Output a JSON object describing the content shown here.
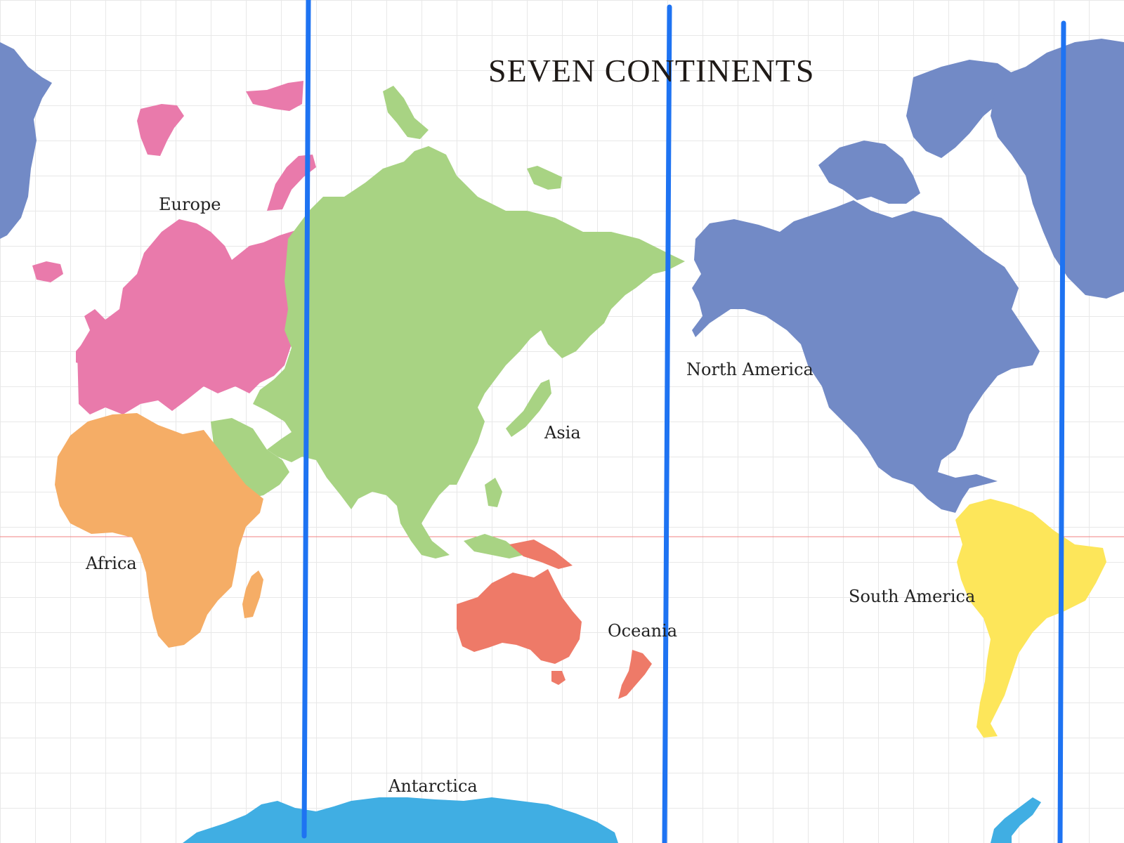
{
  "title": "SEVEN CONTINENTS",
  "labels": {
    "europe": "Europe",
    "asia": "Asia",
    "north_america": "North America",
    "africa": "Africa",
    "south_america": "South America",
    "oceania": "Oceania",
    "antarctica": "Antarctica"
  },
  "colors": {
    "europe": "#e97aab",
    "asia": "#a8d383",
    "north_america": "#728ac6",
    "africa": "#f5ad66",
    "south_america": "#fde65a",
    "oceania": "#ee7a68",
    "antarctica": "#40aee3",
    "grid": "#e8e8e8",
    "equator": "#f08080",
    "drawn_lines": "#1e73f2"
  },
  "map_features": {
    "grid": true,
    "equator_line": true,
    "drawn_vertical_lines": 3
  }
}
